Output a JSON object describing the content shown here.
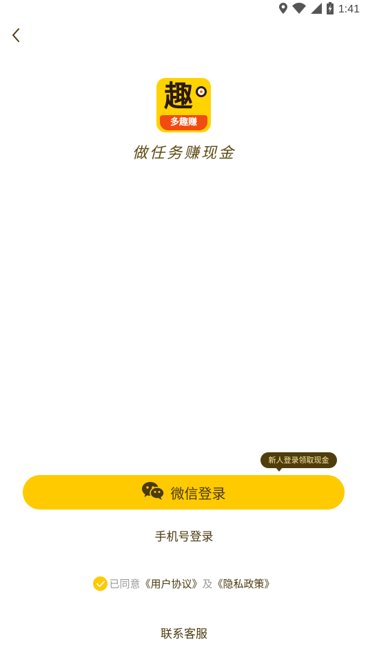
{
  "status_bar": {
    "time": "1:41",
    "icons": [
      "location-icon",
      "wifi-icon",
      "signal-icon",
      "battery-charging-icon"
    ]
  },
  "header": {
    "back_icon": "chevron-left-icon"
  },
  "brand": {
    "logo_char": "趣",
    "logo_ribbon": "多趣赚",
    "slogan": "做任务赚现金"
  },
  "login": {
    "tooltip": "新人登录领取现金",
    "wechat_label": "微信登录",
    "phone_label": "手机号登录"
  },
  "agreement": {
    "prefix": "已同意",
    "user_agreement": "《用户协议》",
    "conjunction": "及",
    "privacy_policy": "《隐私政策》",
    "checked": true
  },
  "support": {
    "label": "联系客服"
  },
  "colors": {
    "accent": "#ffca00",
    "text_brown": "#4a3a10",
    "tooltip_bg": "#4f3d0b",
    "logo_ribbon": "#f24b0f"
  }
}
